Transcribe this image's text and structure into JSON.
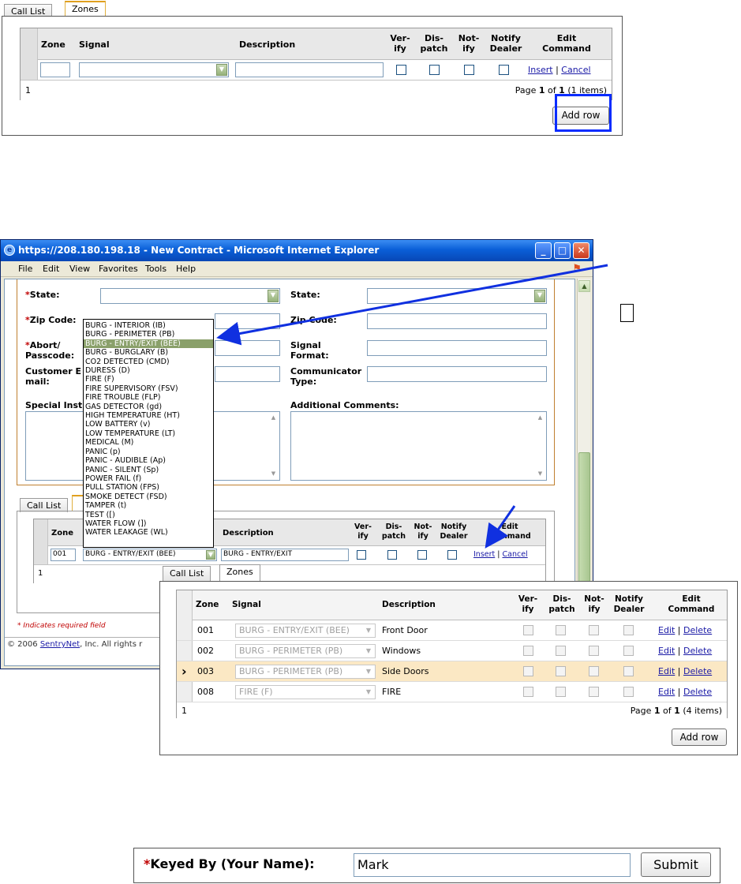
{
  "panel1": {
    "tabs": [
      "Call List",
      "Zones"
    ],
    "headers": {
      "zone": "Zone",
      "signal": "Signal",
      "description": "Description",
      "verify": [
        "Ver-",
        "ify"
      ],
      "dispatch": [
        "Dis-",
        "patch"
      ],
      "notify": [
        "Not-",
        "ify"
      ],
      "notify_dealer": [
        "Notify",
        "Dealer"
      ],
      "edit_command": [
        "Edit",
        "Command"
      ]
    },
    "insert_link": "Insert",
    "cancel_link": "Cancel",
    "separator": "|",
    "footer_count": "1",
    "pager": {
      "prefix": "Page ",
      "current": "1",
      "of": " of ",
      "total": "1",
      "items": " (1 items)"
    },
    "add_row_label": "Add row",
    "highlight_color": "#0a2cff"
  },
  "panel2": {
    "window_title": "https://208.180.198.18 - New Contract - Microsoft Internet Explorer",
    "menu": [
      "File",
      "Edit",
      "View",
      "Favorites",
      "Tools",
      "Help"
    ],
    "fields": {
      "state_req": "State:",
      "state": "State:",
      "zip_req": "Zip Code:",
      "zip": "Zip Code:",
      "abort": [
        "Abort/",
        "Passcode:"
      ],
      "signal_format": [
        "Signal",
        "Format:"
      ],
      "customer_email": [
        "Customer E",
        "mail:"
      ],
      "communicator_type": [
        "Communicator",
        "Type:"
      ],
      "special": "Special Inst",
      "additional": "Additional Comments:"
    },
    "req_mark": "*",
    "dropdown_options": [
      "BURG - INTERIOR (IB)",
      "BURG - PERIMETER (PB)",
      "BURG - ENTRY/EXIT (BEE)",
      "BURG - BURGLARY (B)",
      "CO2 DETECTED (CMD)",
      "DURESS (D)",
      "FIRE (F)",
      "FIRE SUPERVISORY (FSV)",
      "FIRE TROUBLE (FLP)",
      "GAS DETECTOR (gd)",
      "HIGH TEMPERATURE (HT)",
      "LOW BATTERY (v)",
      "LOW TEMPERATURE (LT)",
      "MEDICAL (M)",
      "PANIC (p)",
      "PANIC - AUDIBLE (Ap)",
      "PANIC - SILENT (Sp)",
      "POWER FAIL (f)",
      "PULL STATION (FPS)",
      "SMOKE DETECT (FSD)",
      "TAMPER (t)",
      "TEST ([)",
      "WATER FLOW (])",
      "WATER LEAKAGE (WL)"
    ],
    "dropdown_highlight_index": 2,
    "tabs": [
      "Call List",
      "Zones"
    ],
    "headers": {
      "zone": "Zone",
      "description": "Description",
      "verify": [
        "Ver-",
        "ify"
      ],
      "dispatch": [
        "Dis-",
        "patch"
      ],
      "notify": [
        "Not-",
        "ify"
      ],
      "notify_dealer": [
        "Notify",
        "Dealer"
      ],
      "edit_command": [
        "Edit",
        "Command"
      ]
    },
    "row": {
      "zone": "001",
      "signal": "BURG - ENTRY/EXIT (BEE)",
      "description": "BURG - ENTRY/EXIT"
    },
    "insert_link": "Insert",
    "cancel_link": "Cancel",
    "footer_count": "1",
    "required_note": "* Indicates required field",
    "copyright_prefix": "© 2006 ",
    "copyright_link": "SentryNet",
    "copyright_suffix": ", Inc. All rights r"
  },
  "panel3": {
    "tabs": [
      "Call List",
      "Zones"
    ],
    "headers": {
      "zone": "Zone",
      "signal": "Signal",
      "description": "Description",
      "verify": [
        "Ver-",
        "ify"
      ],
      "dispatch": [
        "Dis-",
        "patch"
      ],
      "notify": [
        "Not-",
        "ify"
      ],
      "notify_dealer": [
        "Notify",
        "Dealer"
      ],
      "edit_command": [
        "Edit",
        "Command"
      ]
    },
    "rows": [
      {
        "zone": "001",
        "signal": "BURG - ENTRY/EXIT (BEE)",
        "description": "Front Door"
      },
      {
        "zone": "002",
        "signal": "BURG - PERIMETER (PB)",
        "description": "Windows"
      },
      {
        "zone": "003",
        "signal": "BURG - PERIMETER (PB)",
        "description": "Side Doors"
      },
      {
        "zone": "008",
        "signal": "FIRE (F)",
        "description": "FIRE"
      }
    ],
    "selected_row_index": 2,
    "row_pointer": "›",
    "edit_link": "Edit",
    "delete_link": "Delete",
    "footer_count": "1",
    "pager": {
      "prefix": "Page ",
      "current": "1",
      "of": " of ",
      "total": "1",
      "items": " (4 items)"
    },
    "add_row_label": "Add row",
    "highlight_row_color": "#fbe8c4"
  },
  "panel4": {
    "req_mark": "*",
    "label": "Keyed By (Your Name):",
    "value": "Mark",
    "submit_label": "Submit"
  },
  "colors": {
    "arrow": "#1030e0",
    "required": "#c00000",
    "link": "#1a1aa6"
  }
}
